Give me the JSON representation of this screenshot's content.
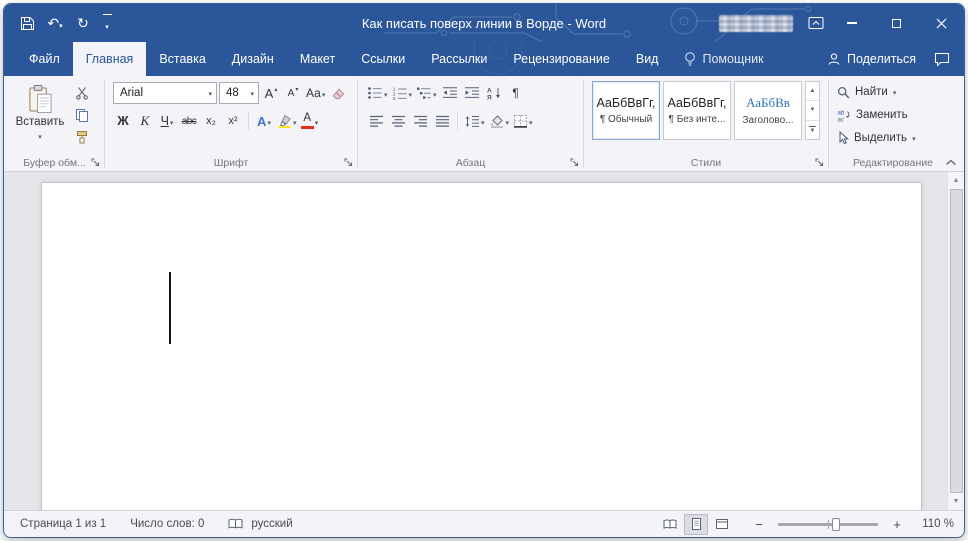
{
  "colors": {
    "titlebar": "#2b579a",
    "accent": "#2b579a",
    "ribbon_bg": "#f3f3f8",
    "highlight_yellow": "#ffe400",
    "font_color_red": "#e0301e",
    "heading_blue": "#2e74b5"
  },
  "window": {
    "title": "Как писать поверх линии в Ворде - Word"
  },
  "icons": {
    "undo": "↶",
    "redo": "↻"
  },
  "tabs": {
    "items": [
      {
        "label": "Файл"
      },
      {
        "label": "Главная"
      },
      {
        "label": "Вставка"
      },
      {
        "label": "Дизайн"
      },
      {
        "label": "Макет"
      },
      {
        "label": "Ссылки"
      },
      {
        "label": "Рассылки"
      },
      {
        "label": "Рецензирование"
      },
      {
        "label": "Вид"
      }
    ],
    "assistant": "Помощник",
    "share": "Поделиться"
  },
  "ribbon": {
    "clipboard": {
      "paste": "Вставить",
      "label": "Буфер обм..."
    },
    "font": {
      "family": "Arial",
      "size": "48",
      "grow": "А",
      "shrink": "А",
      "case": "Аа",
      "bold": "Ж",
      "italic": "К",
      "underline": "Ч",
      "strike": "abc",
      "sub": "x₂",
      "sup": "x²",
      "effects": "А",
      "color": "А",
      "label": "Шрифт"
    },
    "paragraph": {
      "digits": [
        "1",
        "2",
        "3"
      ],
      "sort_top": "А",
      "sort_bottom": "Я",
      "pilcrow": "¶",
      "label": "Абзац"
    },
    "styles": {
      "label": "Стили",
      "items": [
        {
          "sample": "АаБбВвГг,",
          "name": "¶ Обычный"
        },
        {
          "sample": "АаБбВвГг,",
          "name": "¶ Без инте..."
        },
        {
          "sample": "АаБбВв",
          "name": "Заголово..."
        }
      ]
    },
    "editing": {
      "find": "Найти",
      "replace": "Заменить",
      "select": "Выделить",
      "replace_icon_top": "ab",
      "replace_icon_bottom": "ac",
      "label": "Редактирование"
    }
  },
  "status": {
    "page": "Страница 1 из 1",
    "words": "Число слов: 0",
    "language": "русский",
    "zoom_out": "−",
    "zoom_in": "+",
    "zoom": "110 %"
  }
}
